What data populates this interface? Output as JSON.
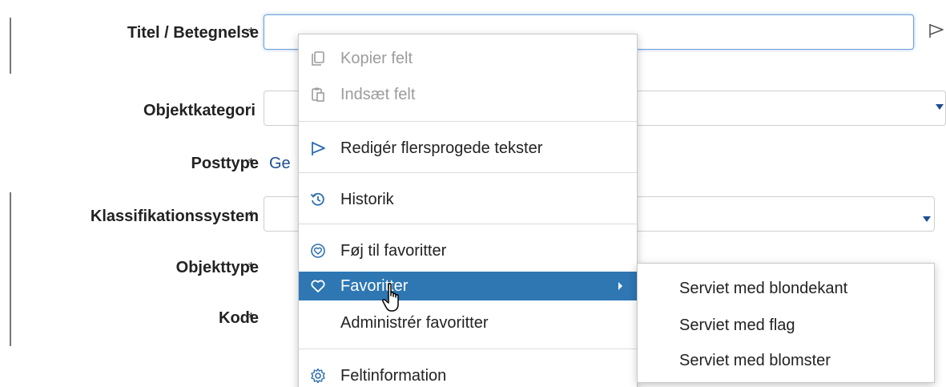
{
  "form": {
    "fields": [
      {
        "label": "Titel / Betegnelse",
        "required": "*"
      },
      {
        "label": "Objektkategori"
      },
      {
        "label": "Posttype",
        "required": "*",
        "value": "Ge"
      },
      {
        "label": "Klassifikationssystem",
        "required": "*"
      },
      {
        "label": "Objekttype",
        "required": "*"
      },
      {
        "label": "Kode",
        "required": "*"
      }
    ]
  },
  "context_menu": {
    "items": [
      {
        "label": "Kopier felt",
        "icon": "copy-icon",
        "state": "disabled"
      },
      {
        "label": "Indsæt felt",
        "icon": "paste-icon",
        "state": "disabled"
      },
      {
        "label": "Redigér flersprogede tekster",
        "icon": "flag-icon"
      },
      {
        "label": "Historik",
        "icon": "history-icon"
      },
      {
        "label": "Føj til favoritter",
        "icon": "favorite-add-icon"
      },
      {
        "label": "Favoritter",
        "icon": "heart-icon",
        "state": "highlighted",
        "has_submenu": true
      },
      {
        "label": "Administrér favoritter"
      },
      {
        "label": "Feltinformation",
        "icon": "gear-icon"
      }
    ]
  },
  "submenu": {
    "items": [
      {
        "label": "Serviet med blondekant"
      },
      {
        "label": "Serviet med flag"
      },
      {
        "label": "Serviet med blomster"
      }
    ]
  },
  "colors": {
    "highlight": "#2e77b3",
    "link": "#1d4f91",
    "focus_border": "#6fa0d8",
    "disabled_text": "#9c9c9c"
  }
}
